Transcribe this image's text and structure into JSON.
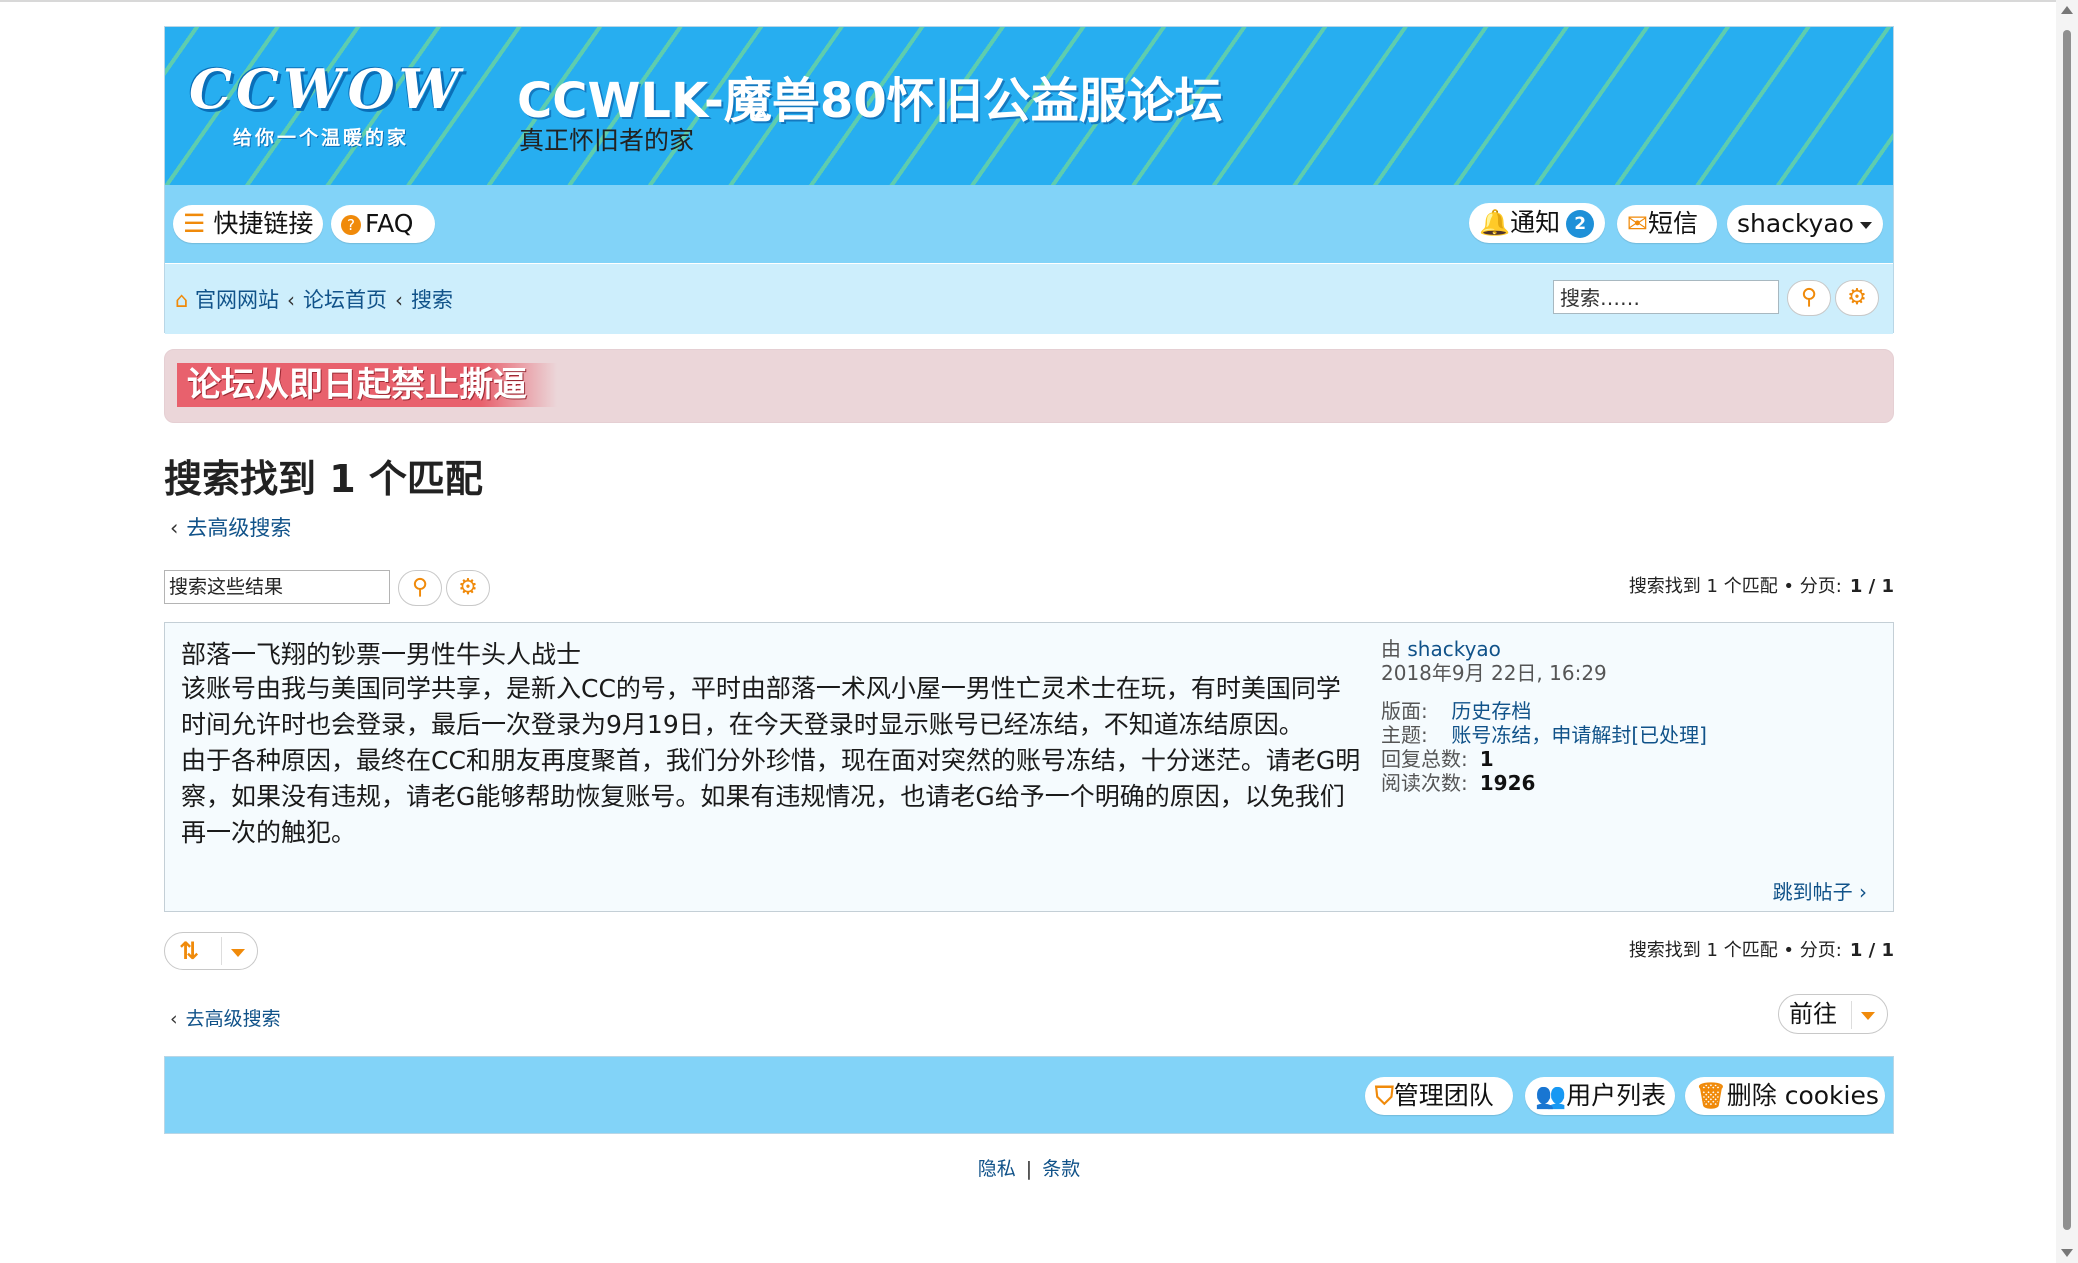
{
  "header": {
    "logo_text": "CCWOW",
    "logo_sub": "给你一个温暖的家",
    "site_title": "CCWLK-魔兽80怀旧公益服论坛",
    "site_desc": "真正怀旧者的家"
  },
  "nav": {
    "quick_links": "快捷链接",
    "faq": "FAQ",
    "notifications": "通知",
    "notification_count": "2",
    "messages": "短信",
    "username": "shackyao"
  },
  "breadcrumbs": {
    "home": "官网网站",
    "forum_index": "论坛首页",
    "search": "搜索"
  },
  "header_search": {
    "placeholder": "搜索……"
  },
  "announcement": "论坛从即日起禁止撕逼",
  "page": {
    "title": "搜索找到 1 个匹配",
    "advanced_search": "去高级搜索",
    "filter_placeholder": "搜索这些结果"
  },
  "pagination": {
    "summary": "搜索找到 1 个匹配 • 分页:",
    "pages": "1 / 1"
  },
  "result": {
    "title": "部落一飞翔的钞票一男性牛头人战士",
    "paragraphs": [
      "该账号由我与美国同学共享，是新入CC的号，平时由部落一术风小屋一男性亡灵术士在玩，有时美国同学时间允许时也会登录，最后一次登录为9月19日，在今天登录时显示账号已经冻结，不知道冻结原因。",
      "由于各种原因，最终在CC和朋友再度聚首，我们分外珍惜，现在面对突然的账号冻结，十分迷茫。请老G明察，如果没有违规，请老G能够帮助恢复账号。如果有违规情况，也请老G给予一个明确的原因，以免我们再一次的触犯。"
    ],
    "by_label": "由",
    "author": "shackyao",
    "datetime": "2018年9月 22日, 16:29",
    "forum_label": "版面:",
    "forum": "历史存档",
    "topic_label": "主题:",
    "topic": "账号冻结，申请解封[已处理]",
    "replies_label": "回复总数:",
    "replies": "1",
    "views_label": "阅读次数:",
    "views": "1926",
    "jump": "跳到帖子"
  },
  "bottom": {
    "goto": "前往",
    "team": "管理团队",
    "members": "用户列表",
    "delete_cookies": "删除 cookies",
    "privacy": "隐私",
    "terms": "条款"
  },
  "colors": {
    "header_bg": "#27aef0",
    "nav_bg": "#82d3f8",
    "crumb_bg": "#cdeefc",
    "link": "#105289",
    "accent": "#f08a0a",
    "announce_bg": "#ebd6d9",
    "announce_label": "#e8616d"
  }
}
